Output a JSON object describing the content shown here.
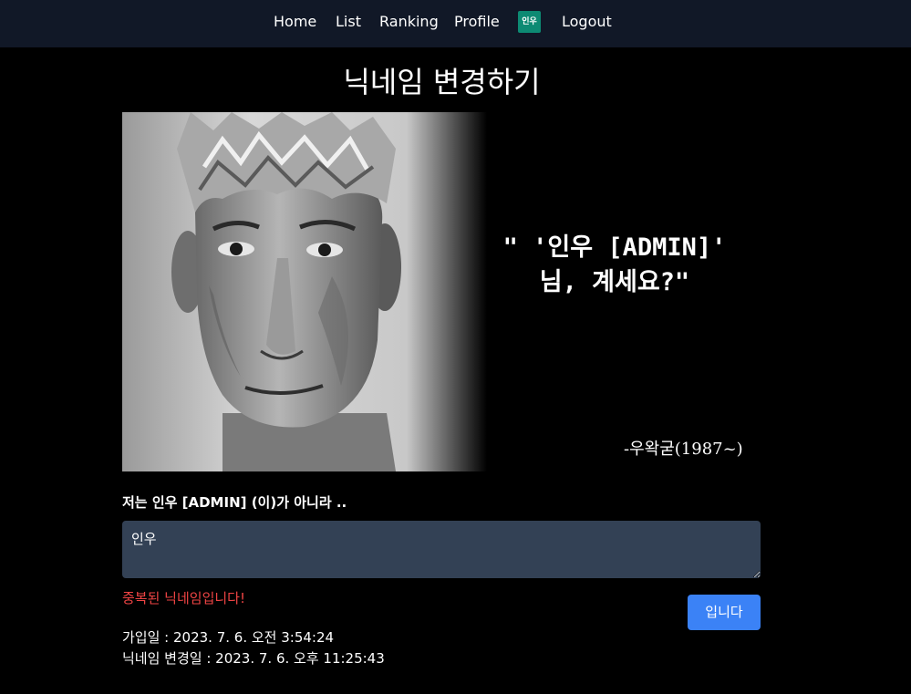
{
  "nav": {
    "home": "Home",
    "list": "List",
    "ranking": "Ranking",
    "profile": "Profile",
    "badge": "인우",
    "logout": "Logout"
  },
  "page": {
    "title": "닉네임 변경하기"
  },
  "banner": {
    "quote_line1": "\" '인우 [ADMIN]'",
    "quote_line2": "님, 계세요?\"",
    "signature": "-우왁굳(1987~)"
  },
  "form": {
    "label": "저는 인우 [ADMIN] (이)가 아니라 ..",
    "input_value": "인우",
    "error": "중복된 닉네임입니다!",
    "submit_label": "입니다"
  },
  "info": {
    "joined": "가입일 : 2023. 7. 6. 오전 3:54:24",
    "changed": "닉네임 변경일 : 2023. 7. 6. 오후 11:25:43"
  },
  "colors": {
    "navbar_bg": "#111827",
    "badge_bg": "#0d8a73",
    "input_bg": "#334155",
    "error": "#ef4444",
    "button_bg": "#3b82f6"
  }
}
